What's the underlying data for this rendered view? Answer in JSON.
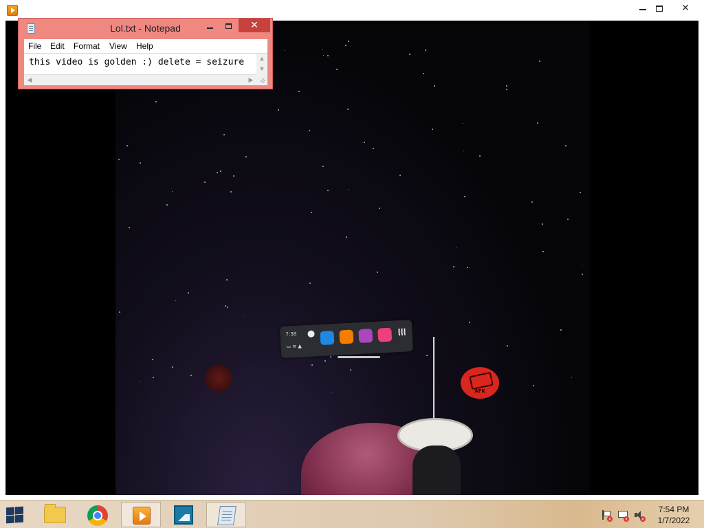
{
  "player": {
    "title": "",
    "controls": {
      "minimize": "",
      "maximize": "",
      "close": "✕"
    }
  },
  "video_overlay": {
    "quest_bar": {
      "time": "7:38",
      "apps": [
        {
          "name": "bluetooth-app",
          "color": "#1e88e5"
        },
        {
          "name": "store-app",
          "color": "#f57c00"
        },
        {
          "name": "people-app",
          "color": "#ab47bc"
        },
        {
          "name": "share-app",
          "color": "#ec407a"
        },
        {
          "name": "avatar-app",
          "color": "#3949ab"
        }
      ]
    },
    "afk_badge": "AFK"
  },
  "notepad": {
    "title": "Lol.txt - Notepad",
    "close_glyph": "✕",
    "menu": [
      "File",
      "Edit",
      "Format",
      "View",
      "Help"
    ],
    "content": "this video is golden :) delete = seizure"
  },
  "taskbar": {
    "pinned": [
      {
        "name": "file-explorer",
        "active": false
      },
      {
        "name": "chrome",
        "active": false
      },
      {
        "name": "media-player",
        "active": true
      },
      {
        "name": "photos",
        "active": false
      },
      {
        "name": "notepad",
        "active": true
      }
    ],
    "clock": {
      "time": "7:54 PM",
      "date": "1/7/2022"
    },
    "tray_mark": "x"
  }
}
